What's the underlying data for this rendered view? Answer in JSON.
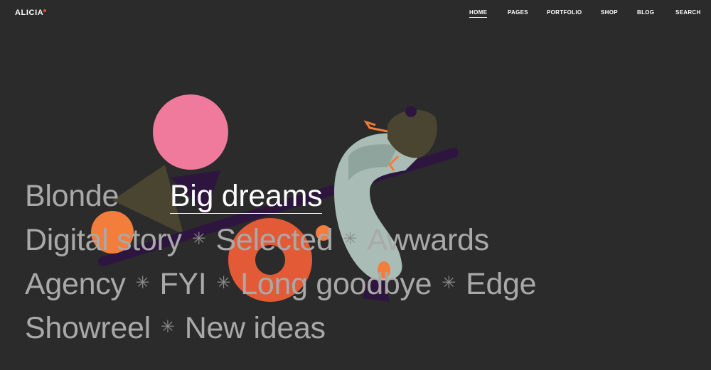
{
  "header": {
    "logo": "ALICIA",
    "nav": [
      {
        "label": "HOME",
        "active": true
      },
      {
        "label": "PAGES",
        "active": false
      },
      {
        "label": "PORTFOLIO",
        "active": false
      },
      {
        "label": "SHOP",
        "active": false
      },
      {
        "label": "BLOG",
        "active": false
      },
      {
        "label": "SEARCH",
        "active": false
      }
    ]
  },
  "projects": {
    "lines": [
      [
        "Blonde",
        "Big dreams"
      ],
      [
        "Digital story",
        "Selected",
        "Awwards"
      ],
      [
        "Agency",
        "FYI",
        "Long goodbye",
        "Edge"
      ],
      [
        "Showreel",
        "New ideas"
      ]
    ],
    "separator": "✳",
    "active": "Big dreams"
  },
  "colors": {
    "background": "#2b2b2b",
    "text_muted": "#a9a9a9",
    "text_active": "#ffffff",
    "accent": "#e8513d",
    "pink": "#ef7a9c",
    "orange": "#f37d3a",
    "olive": "#4a4530",
    "purple": "#2e1540",
    "sage": "#a9bdb6"
  },
  "illustration": {
    "icon": "seesaw-illustration-icon"
  }
}
